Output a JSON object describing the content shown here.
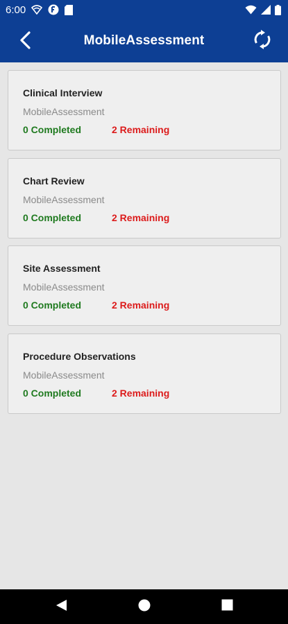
{
  "status_bar": {
    "time": "6:00",
    "left_icons": [
      "wifi-calling-icon",
      "notification-app-icon",
      "sd-card-icon"
    ],
    "right_icons": [
      "wifi-icon",
      "cell-signal-icon",
      "battery-icon"
    ]
  },
  "header": {
    "title": "MobileAssessment",
    "back_icon": "chevron-left-icon",
    "sync_icon": "sync-icon"
  },
  "cards": [
    {
      "title": "Clinical Interview",
      "subtitle": "MobileAssessment",
      "completed": "0 Completed",
      "remaining": "2 Remaining"
    },
    {
      "title": "Chart Review",
      "subtitle": "MobileAssessment",
      "completed": "0 Completed",
      "remaining": "2 Remaining"
    },
    {
      "title": "Site Assessment",
      "subtitle": "MobileAssessment",
      "completed": "0 Completed",
      "remaining": "2 Remaining"
    },
    {
      "title": "Procedure Observations",
      "subtitle": "MobileAssessment",
      "completed": "0 Completed",
      "remaining": "2 Remaining"
    }
  ],
  "nav_bar": {
    "buttons": [
      "back-triangle-icon",
      "home-circle-icon",
      "recents-square-icon"
    ]
  },
  "colors": {
    "header_bg": "#0d3f94",
    "completed": "#1f7a1f",
    "remaining": "#dc1b1b",
    "background": "#e6e6e6"
  }
}
